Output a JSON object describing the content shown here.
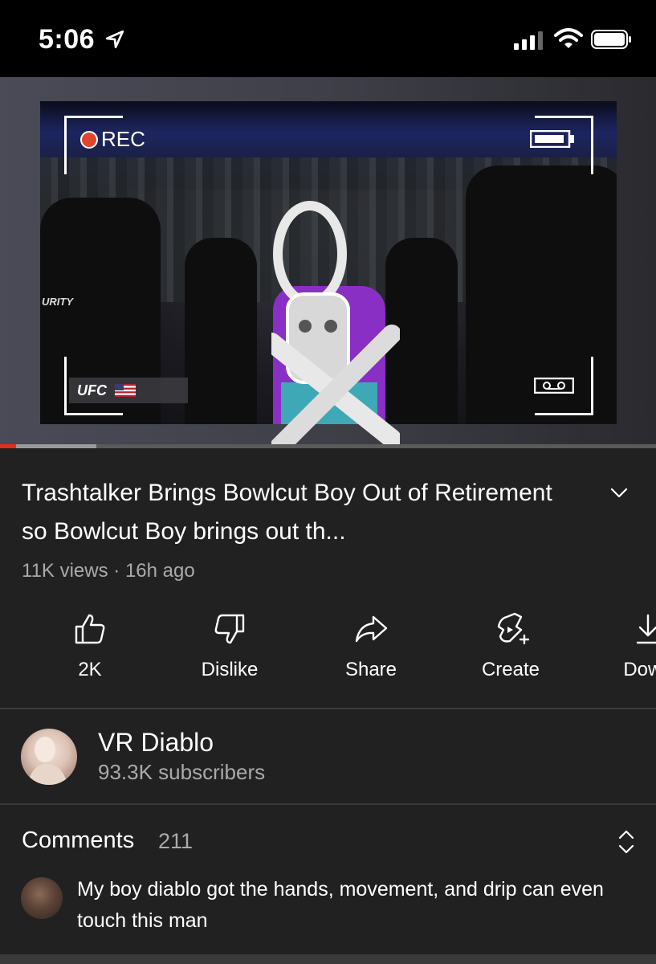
{
  "status_bar": {
    "time": "5:06"
  },
  "video": {
    "rec_label": "REC",
    "ufc_badge": "UFC",
    "bg_text": "URITY",
    "progress_played": 0.025,
    "progress_buffered": 0.147
  },
  "video_info": {
    "title": "Trashtalker Brings Bowlcut Boy Out of Retirement so Bowlcut Boy brings out th...",
    "views": "11K views",
    "separator": "·",
    "age": "16h ago"
  },
  "actions": [
    {
      "label": "2K",
      "icon": "thumbs-up-icon"
    },
    {
      "label": "Dislike",
      "icon": "thumbs-down-icon"
    },
    {
      "label": "Share",
      "icon": "share-icon"
    },
    {
      "label": "Create",
      "icon": "create-icon"
    },
    {
      "label": "Down",
      "icon": "download-icon"
    }
  ],
  "channel": {
    "name": "VR Diablo",
    "subscribers": "93.3K subscribers"
  },
  "comments": {
    "label": "Comments",
    "count": "211",
    "top_comment": "My boy diablo got the hands, movement, and drip can even touch this man"
  },
  "colors": {
    "background": "#212121",
    "progress": "#e22d1f",
    "secondary_text": "#aaaaaa"
  }
}
